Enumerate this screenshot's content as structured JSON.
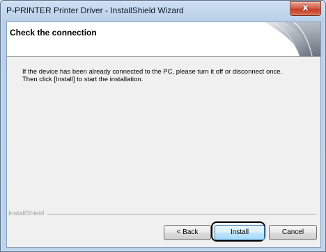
{
  "window": {
    "title": "P-PRINTER Printer Driver - InstallShield Wizard",
    "close_symbol": "x"
  },
  "header": {
    "title": "Check the connection"
  },
  "body": {
    "line1": "If the device has been already connected to the PC, please turn it off or disconnect once.",
    "line2": "Then click [Install] to start the installation."
  },
  "footer": {
    "brand_label": "InstallShield"
  },
  "buttons": {
    "back": "< Back",
    "install": "Install",
    "cancel": "Cancel"
  },
  "colors": {
    "accent": "#3c7fb1",
    "close_button": "#c3402a"
  }
}
